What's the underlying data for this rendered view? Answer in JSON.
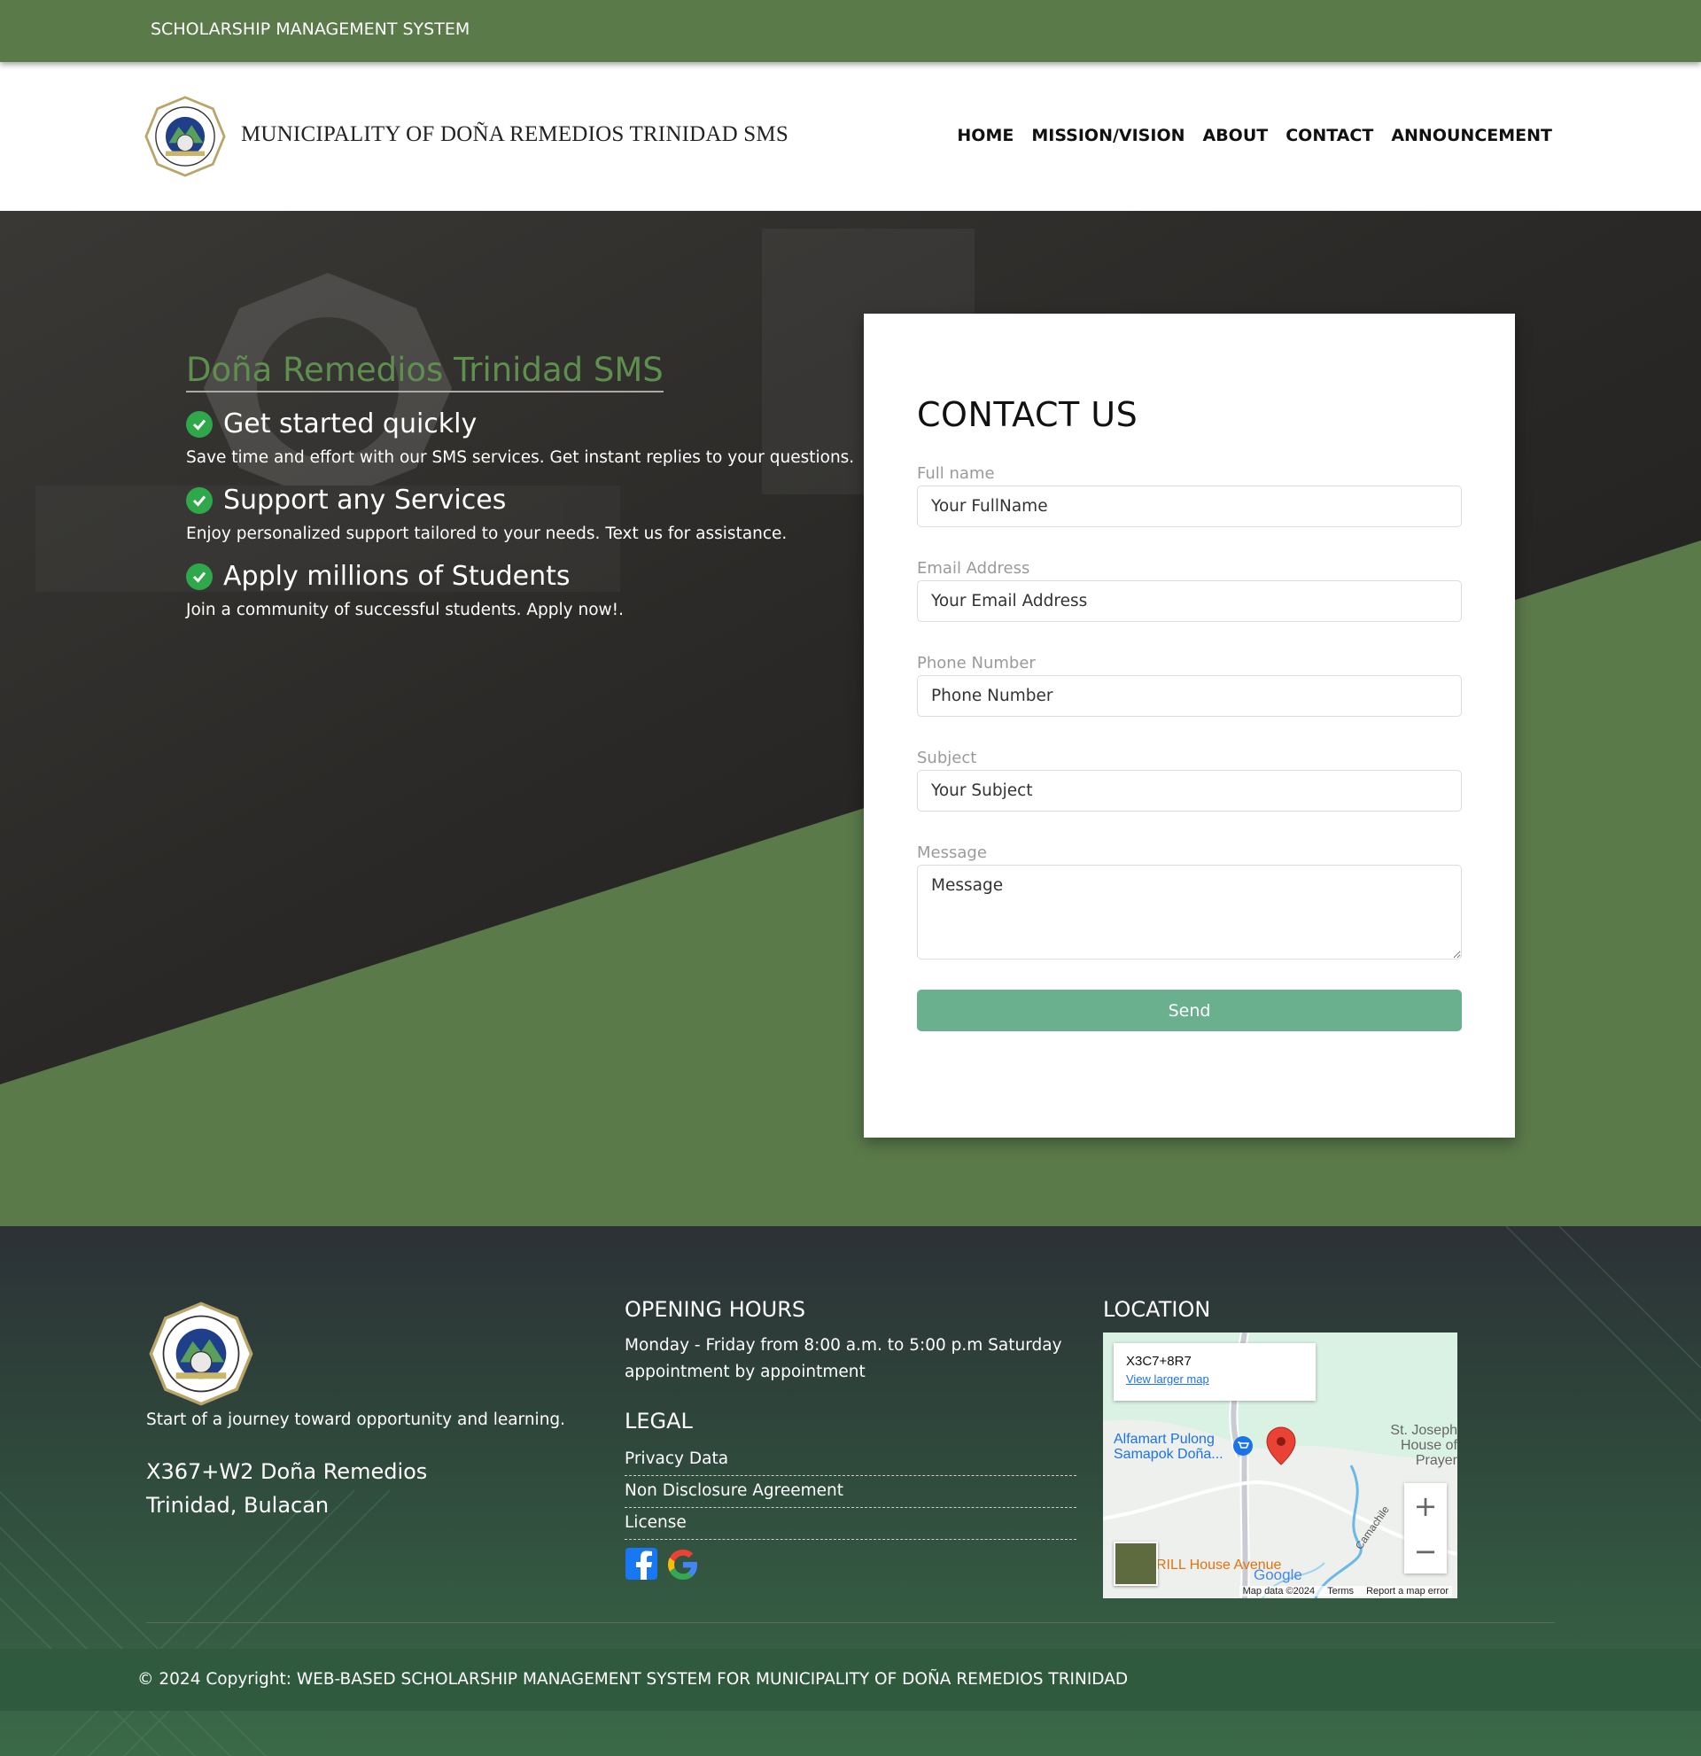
{
  "topbar": {
    "title": "SCHOLARSHIP MANAGEMENT SYSTEM"
  },
  "header": {
    "site_name": "MUNICIPALITY OF DOÑA REMEDIOS TRINIDAD SMS",
    "nav": [
      "HOME",
      "MISSION/VISION",
      "ABOUT",
      "CONTACT",
      "ANNOUNCEMENT"
    ]
  },
  "hero": {
    "title": "Doña Remedios Trinidad SMS",
    "features": [
      {
        "heading": "Get started quickly",
        "text": "Save time and effort with our SMS services. Get instant replies to your questions."
      },
      {
        "heading": "Support any Services",
        "text": "Enjoy personalized support tailored to your needs. Text us for assistance."
      },
      {
        "heading": "Apply millions of Students",
        "text": "Join a community of successful students. Apply now!."
      }
    ]
  },
  "contact": {
    "heading": "CONTACT US",
    "fields": [
      {
        "label": "Full name",
        "placeholder": "Your FullName"
      },
      {
        "label": "Email Address",
        "placeholder": "Your Email Address"
      },
      {
        "label": "Phone Number",
        "placeholder": "Phone Number"
      },
      {
        "label": "Subject",
        "placeholder": "Your Subject"
      },
      {
        "label": "Message",
        "placeholder": "Message"
      }
    ],
    "send_label": "Send"
  },
  "footer": {
    "tagline": "Start of a journey toward opportunity and learning.",
    "address_line1": "X367+W2 Doña Remedios",
    "address_line2": "Trinidad, Bulacan",
    "hours_heading": "OPENING HOURS",
    "hours_text": "Monday - Friday from 8:00 a.m. to 5:00 p.m Saturday appointment by appointment",
    "legal_heading": "LEGAL",
    "legal_links": [
      "Privacy Data",
      "Non Disclosure Agreement",
      "License"
    ],
    "location_heading": "LOCATION",
    "map": {
      "code": "X3C7+8R7",
      "larger_map": "View larger map",
      "place1": "Alfamart Pulong Samapok Doña...",
      "place2": "St. Joseph House of Prayer",
      "place3": "RILL House Avenue",
      "river": "Camachile",
      "brand": "Google",
      "map_data": "Map data ©2024",
      "terms": "Terms",
      "report": "Report a map error",
      "zoom_in": "+",
      "zoom_out": "−"
    },
    "copyright": "© 2024 Copyright: WEB-BASED SCHOLARSHIP MANAGEMENT SYSTEM FOR MUNICIPALITY OF DOÑA REMEDIOS TRINIDAD"
  },
  "colors": {
    "primary_green": "#5a7a4a",
    "send_button": "#6ab08f",
    "check": "#2ea84a"
  },
  "icons": [
    "official-seal",
    "check-circle-icon",
    "facebook-icon",
    "google-icon",
    "map-pin-icon",
    "shopping-cart-icon"
  ]
}
